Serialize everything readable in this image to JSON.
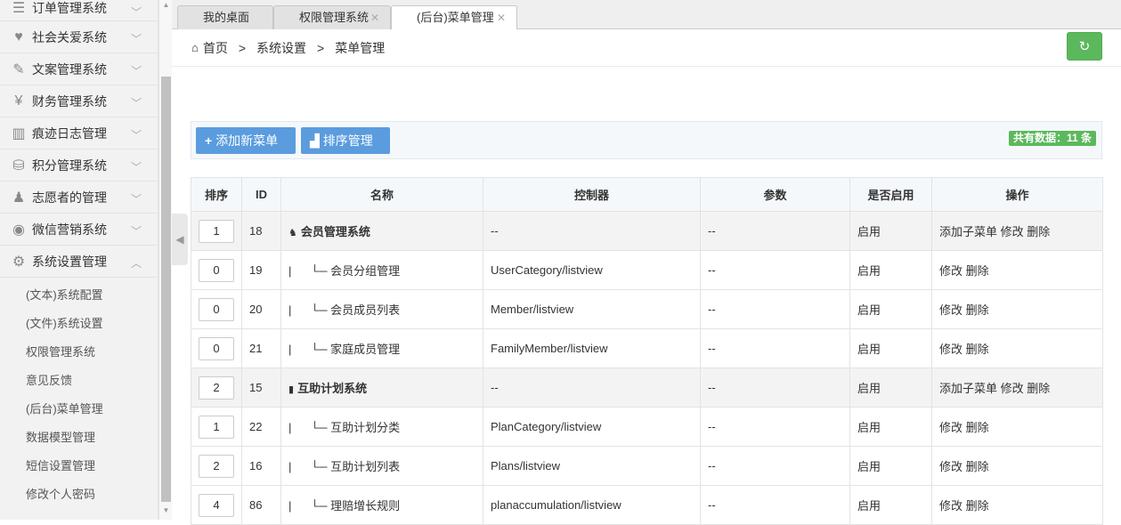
{
  "sidebar": {
    "items": [
      {
        "icon": "list-icon",
        "glyph": "☰",
        "label": "订单管理系统",
        "expanded": false
      },
      {
        "icon": "heart-icon",
        "glyph": "♥",
        "label": "社会关爱系统",
        "expanded": false
      },
      {
        "icon": "pencil-icon",
        "glyph": "✎",
        "label": "文案管理系统",
        "expanded": false
      },
      {
        "icon": "yen-icon",
        "glyph": "¥",
        "label": "财务管理系统",
        "expanded": false
      },
      {
        "icon": "log-icon",
        "glyph": "▥",
        "label": "痕迹日志管理",
        "expanded": false
      },
      {
        "icon": "database-icon",
        "glyph": "⛁",
        "label": "积分管理系统",
        "expanded": false
      },
      {
        "icon": "volunteer-icon",
        "glyph": "♟",
        "label": "志愿者的管理",
        "expanded": false
      },
      {
        "icon": "wechat-icon",
        "glyph": "◉",
        "label": "微信营销系统",
        "expanded": false
      },
      {
        "icon": "gear-icon",
        "glyph": "⚙",
        "label": "系统设置管理",
        "expanded": true
      }
    ],
    "subitems": [
      "(文本)系统配置",
      "(文件)系统设置",
      "权限管理系统",
      "意见反馈",
      "(后台)菜单管理",
      "数据模型管理",
      "短信设置管理",
      "修改个人密码"
    ]
  },
  "tabs": [
    {
      "label": "我的桌面",
      "closable": false
    },
    {
      "label": "权限管理系统",
      "closable": true
    },
    {
      "label": "(后台)菜单管理",
      "closable": true,
      "active": true
    }
  ],
  "breadcrumb": {
    "home": "首页",
    "level1": "系统设置",
    "level2": "菜单管理",
    "sep": ">"
  },
  "toolbar": {
    "add_label": "添加新菜单",
    "sort_label": "排序管理",
    "count_label": "共有数据：11 条"
  },
  "table": {
    "headers": [
      "排序",
      "ID",
      "名称",
      "控制器",
      "参数",
      "是否启用",
      "操作"
    ],
    "rows": [
      {
        "sort": "1",
        "id": "18",
        "parent": true,
        "name": "会员管理系统",
        "controller": "--",
        "params": "--",
        "enabled": "启用",
        "ops": "添加子菜单 修改 删除"
      },
      {
        "sort": "0",
        "id": "19",
        "parent": false,
        "name": "会员分组管理",
        "controller": "UserCategory/listview",
        "params": "--",
        "enabled": "启用",
        "ops": "修改 删除"
      },
      {
        "sort": "0",
        "id": "20",
        "parent": false,
        "name": "会员成员列表",
        "controller": "Member/listview",
        "params": "--",
        "enabled": "启用",
        "ops": "修改 删除"
      },
      {
        "sort": "0",
        "id": "21",
        "parent": false,
        "name": "家庭成员管理",
        "controller": "FamilyMember/listview",
        "params": "--",
        "enabled": "启用",
        "ops": "修改 删除"
      },
      {
        "sort": "2",
        "id": "15",
        "parent": true,
        "name": "互助计划系统",
        "controller": "--",
        "params": "--",
        "enabled": "启用",
        "ops": "添加子菜单 修改 删除"
      },
      {
        "sort": "1",
        "id": "22",
        "parent": false,
        "name": "互助计划分类",
        "controller": "PlanCategory/listview",
        "params": "--",
        "enabled": "启用",
        "ops": "修改 删除"
      },
      {
        "sort": "2",
        "id": "16",
        "parent": false,
        "name": "互助计划列表",
        "controller": "Plans/listview",
        "params": "--",
        "enabled": "启用",
        "ops": "修改 删除"
      },
      {
        "sort": "4",
        "id": "86",
        "parent": false,
        "name": "理赔增长规则",
        "controller": "planaccumulation/listview",
        "params": "--",
        "enabled": "启用",
        "ops": "修改 删除"
      }
    ],
    "tree_prefix": "|      └─ "
  }
}
